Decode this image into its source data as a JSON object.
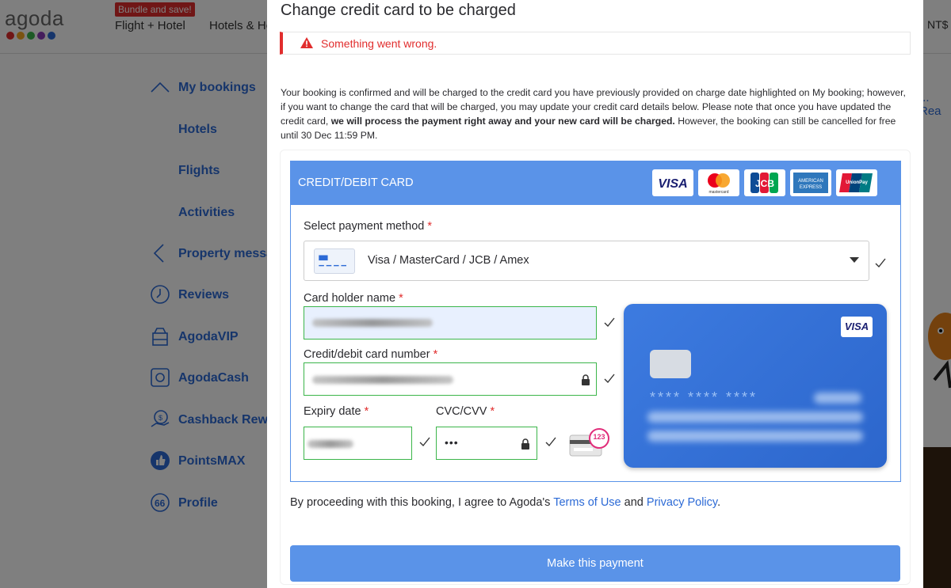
{
  "background": {
    "logo": "agoda",
    "logo_dot_colors": [
      "#e12d2d",
      "#f5a623",
      "#3bb54a",
      "#8b3ab8",
      "#2c6ad6"
    ],
    "bundle_badge": "Bundle and save!",
    "nav_flight_hotel": "Flight + Hotel",
    "nav_hotels_partial": "Hotels & Ho",
    "currency_partial": "NT$",
    "right_link_partial": "... Rea",
    "sidebar": {
      "my_bookings": "My bookings",
      "hotels": "Hotels",
      "flights": "Flights",
      "activities": "Activities",
      "property_messages": "Property messa",
      "reviews": "Reviews",
      "agoda_vip": "AgodaVIP",
      "agoda_cash": "AgodaCash",
      "cashback": "Cashback Rewa",
      "pointsmax": "PointsMAX",
      "profile": "Profile"
    }
  },
  "modal": {
    "title": "Change credit card to be charged",
    "error": "Something went wrong.",
    "info_text_1": "Your booking is confirmed and will be charged to the credit card you have previously provided on charge date highlighted on My booking; however, if you want to change the card that will be charged, you may update your credit card details below. Please note that once you have updated the credit card,",
    "info_bold": "we will process the payment right away and your new card will be charged.",
    "info_text_2": "However, the booking can still be cancelled for free until 30 Dec 11:59 PM.",
    "card_header": "CREDIT/DEBIT CARD",
    "brands": [
      "VISA",
      "mastercard",
      "JCB",
      "AMERICAN EXPRESS",
      "UnionPay"
    ],
    "select_label": "Select payment method",
    "select_value": "Visa / MasterCard / JCB / Amex",
    "holder_label": "Card holder name",
    "number_label": "Credit/debit card number",
    "expiry_label": "Expiry date",
    "cvc_label": "CVC/CVV",
    "cvc_value": "•••",
    "cvc_hint": "123",
    "card_visual_brand": "VISA",
    "card_visual_number": "**** **** ****",
    "required_mark": "*",
    "agree_prefix": "By proceeding with this booking, I agree to Agoda's",
    "terms": "Terms of Use",
    "and": "and",
    "privacy": "Privacy Policy",
    "period": ".",
    "pay_button": "Make this payment"
  },
  "colors": {
    "accent": "#5a93e8",
    "link": "#2c6ad6",
    "error": "#e12d2d",
    "valid": "#3bb54a"
  }
}
